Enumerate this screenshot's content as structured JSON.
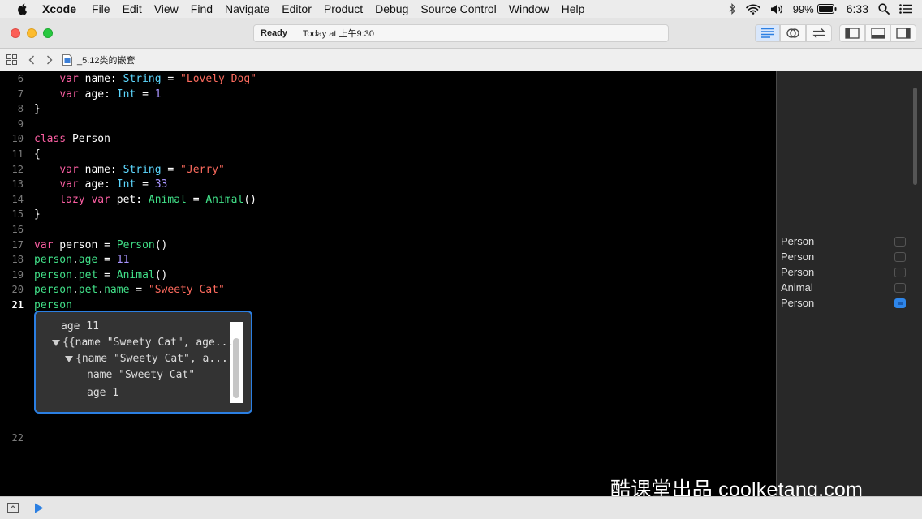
{
  "menubar": {
    "items": [
      "Xcode",
      "File",
      "Edit",
      "View",
      "Find",
      "Navigate",
      "Editor",
      "Product",
      "Debug",
      "Source Control",
      "Window",
      "Help"
    ],
    "battery": "99%",
    "time": "6:33"
  },
  "activity": {
    "status": "Ready",
    "detail": "Today at 上午9:30"
  },
  "jumpbar": {
    "file": "_5.12类的嵌套"
  },
  "code": {
    "lines": [
      {
        "n": "6",
        "html": "    <span class=\"kw\">var</span> name: <span class=\"ty\">String</span> = <span class=\"str\">\"Lovely Dog\"</span>"
      },
      {
        "n": "7",
        "html": "    <span class=\"kw\">var</span> age: <span class=\"ty\">Int</span> = <span class=\"num\">1</span>"
      },
      {
        "n": "8",
        "html": "}"
      },
      {
        "n": "9",
        "html": ""
      },
      {
        "n": "10",
        "html": "<span class=\"kw\">class</span> Person"
      },
      {
        "n": "11",
        "html": "{"
      },
      {
        "n": "12",
        "html": "    <span class=\"kw\">var</span> name: <span class=\"ty\">String</span> = <span class=\"str\">\"Jerry\"</span>"
      },
      {
        "n": "13",
        "html": "    <span class=\"kw\">var</span> age: <span class=\"ty\">Int</span> = <span class=\"num\">33</span>"
      },
      {
        "n": "14",
        "html": "    <span class=\"kw\">lazy</span> <span class=\"kw\">var</span> pet: <span class=\"tyc\">Animal</span> = <span class=\"tyc\">Animal</span>()"
      },
      {
        "n": "15",
        "html": "}"
      },
      {
        "n": "16",
        "html": ""
      },
      {
        "n": "17",
        "html": "<span class=\"kw\">var</span> person = <span class=\"tyc\">Person</span>()"
      },
      {
        "n": "18",
        "html": "<span class=\"tyc\">person</span>.<span class=\"tyc\">age</span> = <span class=\"num\">11</span>"
      },
      {
        "n": "19",
        "html": "<span class=\"tyc\">person</span>.<span class=\"tyc\">pet</span> = <span class=\"tyc\">Animal</span>()"
      },
      {
        "n": "20",
        "html": "<span class=\"tyc\">person</span>.<span class=\"tyc\">pet</span>.<span class=\"tyc\">name</span> = <span class=\"str\">\"Sweety Cat\"</span>"
      },
      {
        "n": "21",
        "html": "<span class=\"tyc\">person</span>",
        "current": true
      }
    ],
    "last_line": "22"
  },
  "quicklook": {
    "lines": [
      {
        "text": "age 11",
        "indent": 0,
        "tri": false
      },
      {
        "text": "{{name \"Sweety Cat\", age...",
        "indent": 0,
        "tri": true
      },
      {
        "text": "{name \"Sweety Cat\", a...",
        "indent": 1,
        "tri": true
      },
      {
        "text": "name \"Sweety Cat\"",
        "indent": 2,
        "tri": false
      },
      {
        "text": "age 1",
        "indent": 2,
        "tri": false
      }
    ]
  },
  "results": [
    {
      "text": "Person",
      "active": false
    },
    {
      "text": "Person",
      "active": false
    },
    {
      "text": "Person",
      "active": false
    },
    {
      "text": "Animal",
      "active": false
    },
    {
      "text": "Person",
      "active": true
    }
  ],
  "watermark": "酷课堂出品 coolketang.com",
  "colors": {
    "keyword": "#fc5fa3",
    "type": "#5dd8ff",
    "class_type": "#41e088",
    "string": "#fc6a5d",
    "number": "#a995ff",
    "accent": "#2b7fe2"
  }
}
